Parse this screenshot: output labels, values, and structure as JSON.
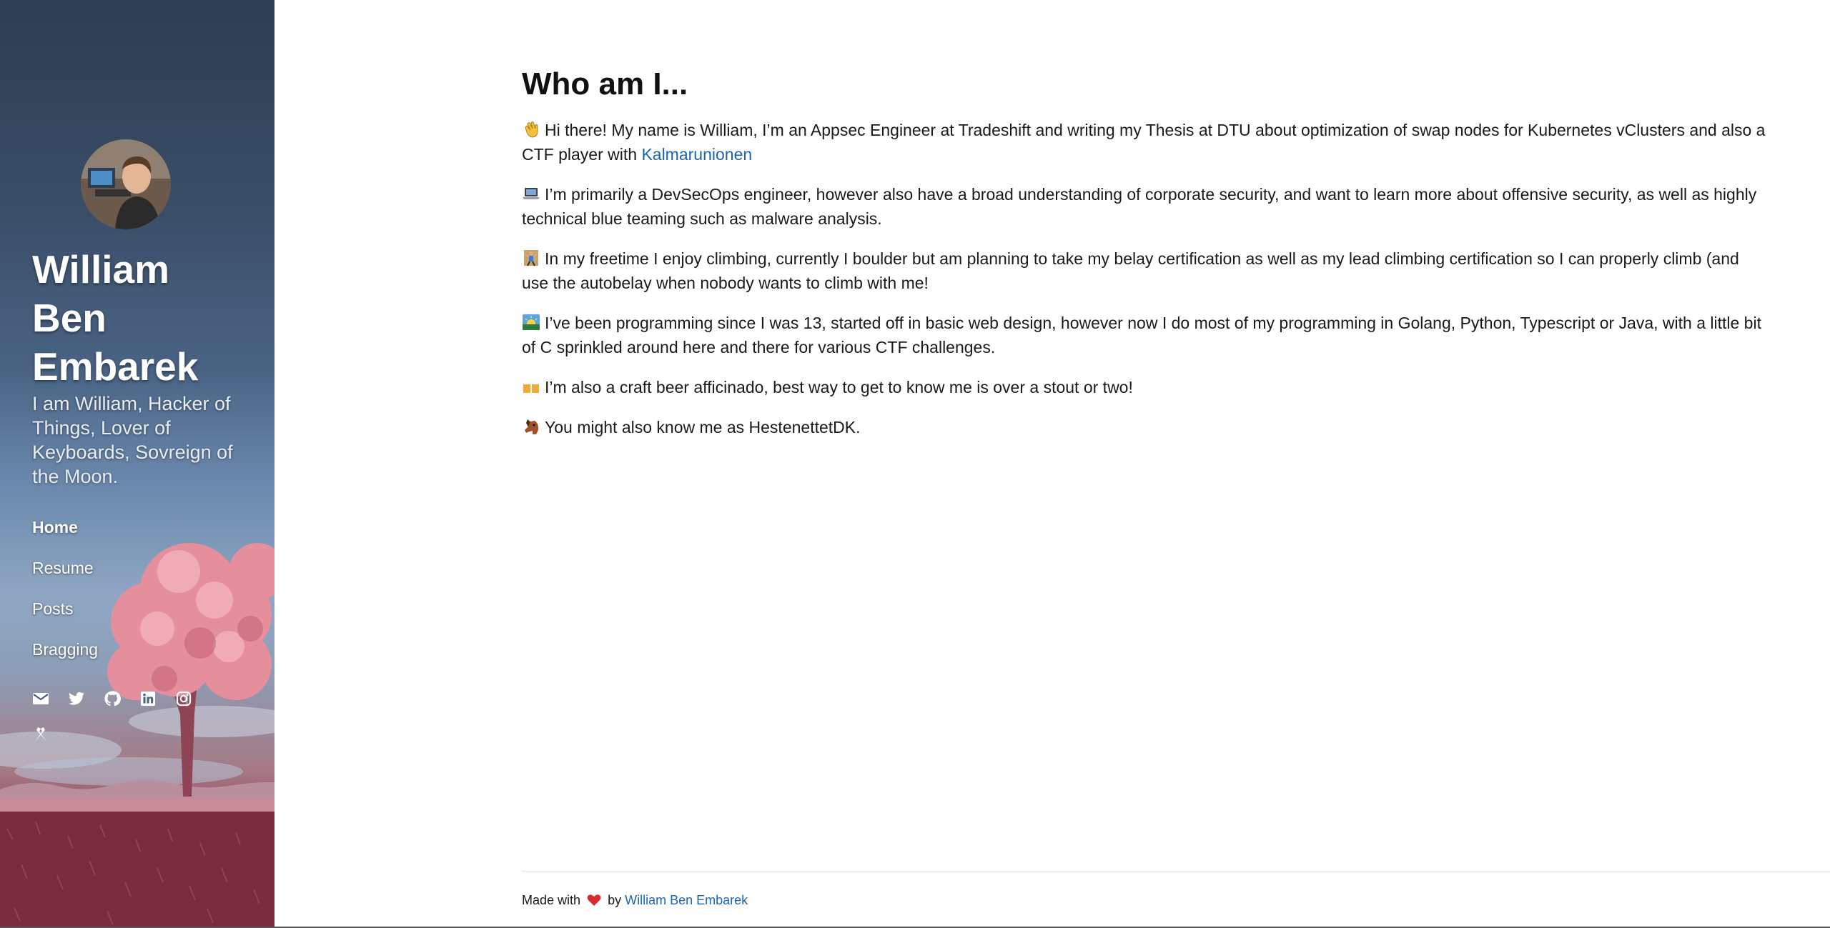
{
  "sidebar": {
    "name": "William Ben Embarek",
    "name_lines": [
      "William",
      "Ben",
      "Embarek"
    ],
    "tagline": "I am William, Hacker of Things, Lover of Keyboards, Sovreign of the Moon.",
    "nav": [
      {
        "label": "Home",
        "active": true
      },
      {
        "label": "Resume",
        "active": false
      },
      {
        "label": "Posts",
        "active": false
      },
      {
        "label": "Bragging",
        "active": false
      }
    ],
    "social_icons": [
      "email-icon",
      "twitter-icon",
      "github-icon",
      "linkedin-icon",
      "instagram-icon",
      "hackthebox-icon"
    ]
  },
  "main": {
    "heading": "Who am I...",
    "paragraphs": [
      {
        "emoji": "waving-hand-icon",
        "text": "Hi there! My name is William, I’m an Appsec Engineer at Tradeshift and writing my Thesis at DTU about optimization of swap nodes for Kubernetes vClusters and also a CTF player with ",
        "link": "Kalmarunionen"
      },
      {
        "emoji": "laptop-icon",
        "text": "I’m primarily a DevSecOps engineer, however also have a broad understanding of corporate security, and want to learn more about offensive security, as well as highly technical blue teaming such as malware analysis."
      },
      {
        "emoji": "climbing-icon",
        "text": "In my freetime I enjoy climbing, currently I boulder but am planning to take my belay certification as well as my lead climbing certification so I can properly climb (and use the autobelay when nobody wants to climb with me!"
      },
      {
        "emoji": "sunrise-icon",
        "text": "I’ve been programming since I was 13, started off in basic web design, however now I do most of my programming in Golang, Python, Typescript or Java, with a little bit of C sprinkled around here and there for various CTF challenges."
      },
      {
        "emoji": "beer-mugs-icon",
        "text": "I’m also a craft beer afficinado, best way to get to know me is over a stout or two!"
      },
      {
        "emoji": "horse-face-icon",
        "text": "You might also know me as HestenettetDK."
      }
    ]
  },
  "footer": {
    "made_with": "Made with",
    "by": "by",
    "author_link": "William Ben Embarek"
  },
  "colors": {
    "link": "#1b66b1",
    "heart": "#d92b2b"
  }
}
